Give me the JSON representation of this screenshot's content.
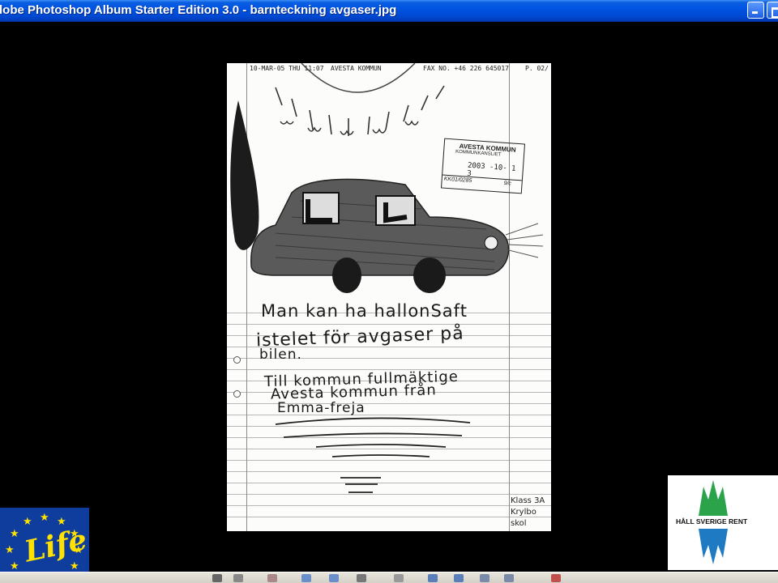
{
  "window": {
    "title": "dobe Photoshop Album Starter Edition 3.0 - barnteckning avgaser.jpg",
    "buttons": [
      "minimize",
      "restore"
    ]
  },
  "drawing": {
    "fax_header": {
      "datetime": "10-MAR-05 THU 11:07",
      "sender": "AVESTA KOMMUN",
      "fax_no": "FAX NO. +46 226 645017",
      "page": "P. 02/"
    },
    "stamp": {
      "line1": "AVESTA KOMMUN",
      "line2": "KOMMUNKANSLIET",
      "date": "2003 -10- 1 3",
      "ref": "KK01/0285",
      "code": "9/c"
    },
    "handwriting": {
      "line1": "Man kan ha hallonSaft",
      "line2": "istelet för avgaser på",
      "line3": "bilen.",
      "line4": "Till kommun fullmäktige",
      "line5": "Avesta kommun från",
      "line6": "Emma-freja"
    },
    "class_note": {
      "line1": "Klass 3A",
      "line2": "Krylbo skol"
    }
  },
  "logos": {
    "life": {
      "text": "Life",
      "icon": "eu-life-logo"
    },
    "hall_sverige_rent": {
      "text": "HÅLL SVERIGE RENT",
      "icon": "mountains-logo",
      "colors": [
        "#2aa34a",
        "#1f7ac4"
      ]
    }
  },
  "colors": {
    "titlebar": "#0054e3",
    "background": "#000000",
    "eu_blue": "#0e3d9e",
    "eu_yellow": "#ffe100"
  }
}
